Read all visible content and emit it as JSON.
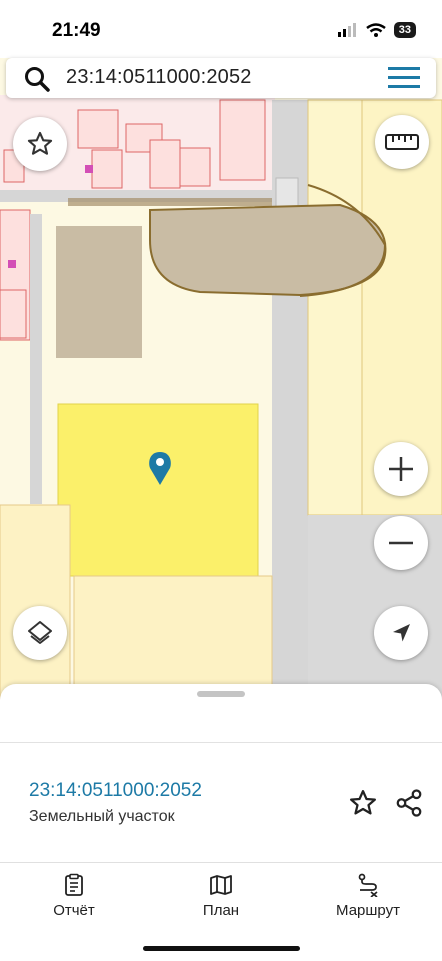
{
  "status_bar": {
    "time": "21:49",
    "battery": "33"
  },
  "search": {
    "query": "23:14:0511000:2052"
  },
  "map": {
    "colors": {
      "selected_parcel": "#fbf06a",
      "parcel_fill": "#fcf5c4",
      "building": "#c9bca4",
      "road": "#d6d6d6",
      "pin": "#1d7aa6"
    }
  },
  "controls": {
    "favorite": "star-icon",
    "ruler": "ruler-icon",
    "zoom_in": "plus-icon",
    "zoom_out": "minus-icon",
    "layers": "layers-icon",
    "locate": "navigation-arrow-icon"
  },
  "sheet": {
    "cadastral_number": "23:14:0511000:2052",
    "object_type": "Земельный участок"
  },
  "tabs": [
    {
      "label": "Отчёт",
      "icon": "clipboard-icon"
    },
    {
      "label": "План",
      "icon": "map-icon"
    },
    {
      "label": "Маршрут",
      "icon": "route-icon"
    }
  ]
}
